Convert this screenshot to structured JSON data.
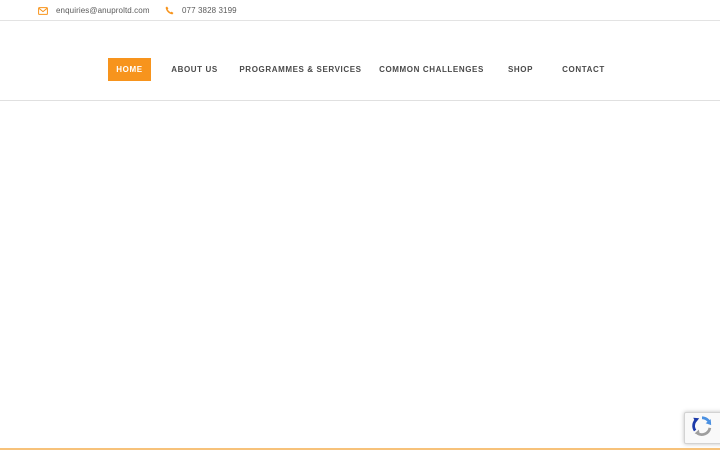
{
  "topbar": {
    "email": {
      "icon": "envelope-icon",
      "text": "enquiries@anuproltd.com"
    },
    "phone": {
      "icon": "phone-icon",
      "text": "077 3828 3199"
    }
  },
  "nav": {
    "items": [
      {
        "label": "HOME",
        "active": true
      },
      {
        "label": "ABOUT US",
        "active": false
      },
      {
        "label": "PROGRAMMES & SERVICES",
        "active": false
      },
      {
        "label": "COMMON CHALLENGES",
        "active": false
      },
      {
        "label": "SHOP",
        "active": false
      },
      {
        "label": "CONTACT",
        "active": false
      }
    ]
  },
  "recaptcha": {
    "icon": "recaptcha-icon"
  },
  "colors": {
    "accent": "#f7941d",
    "text": "#4a4a4a",
    "muted": "#5a5a5a",
    "border": "#e0e0e0"
  }
}
